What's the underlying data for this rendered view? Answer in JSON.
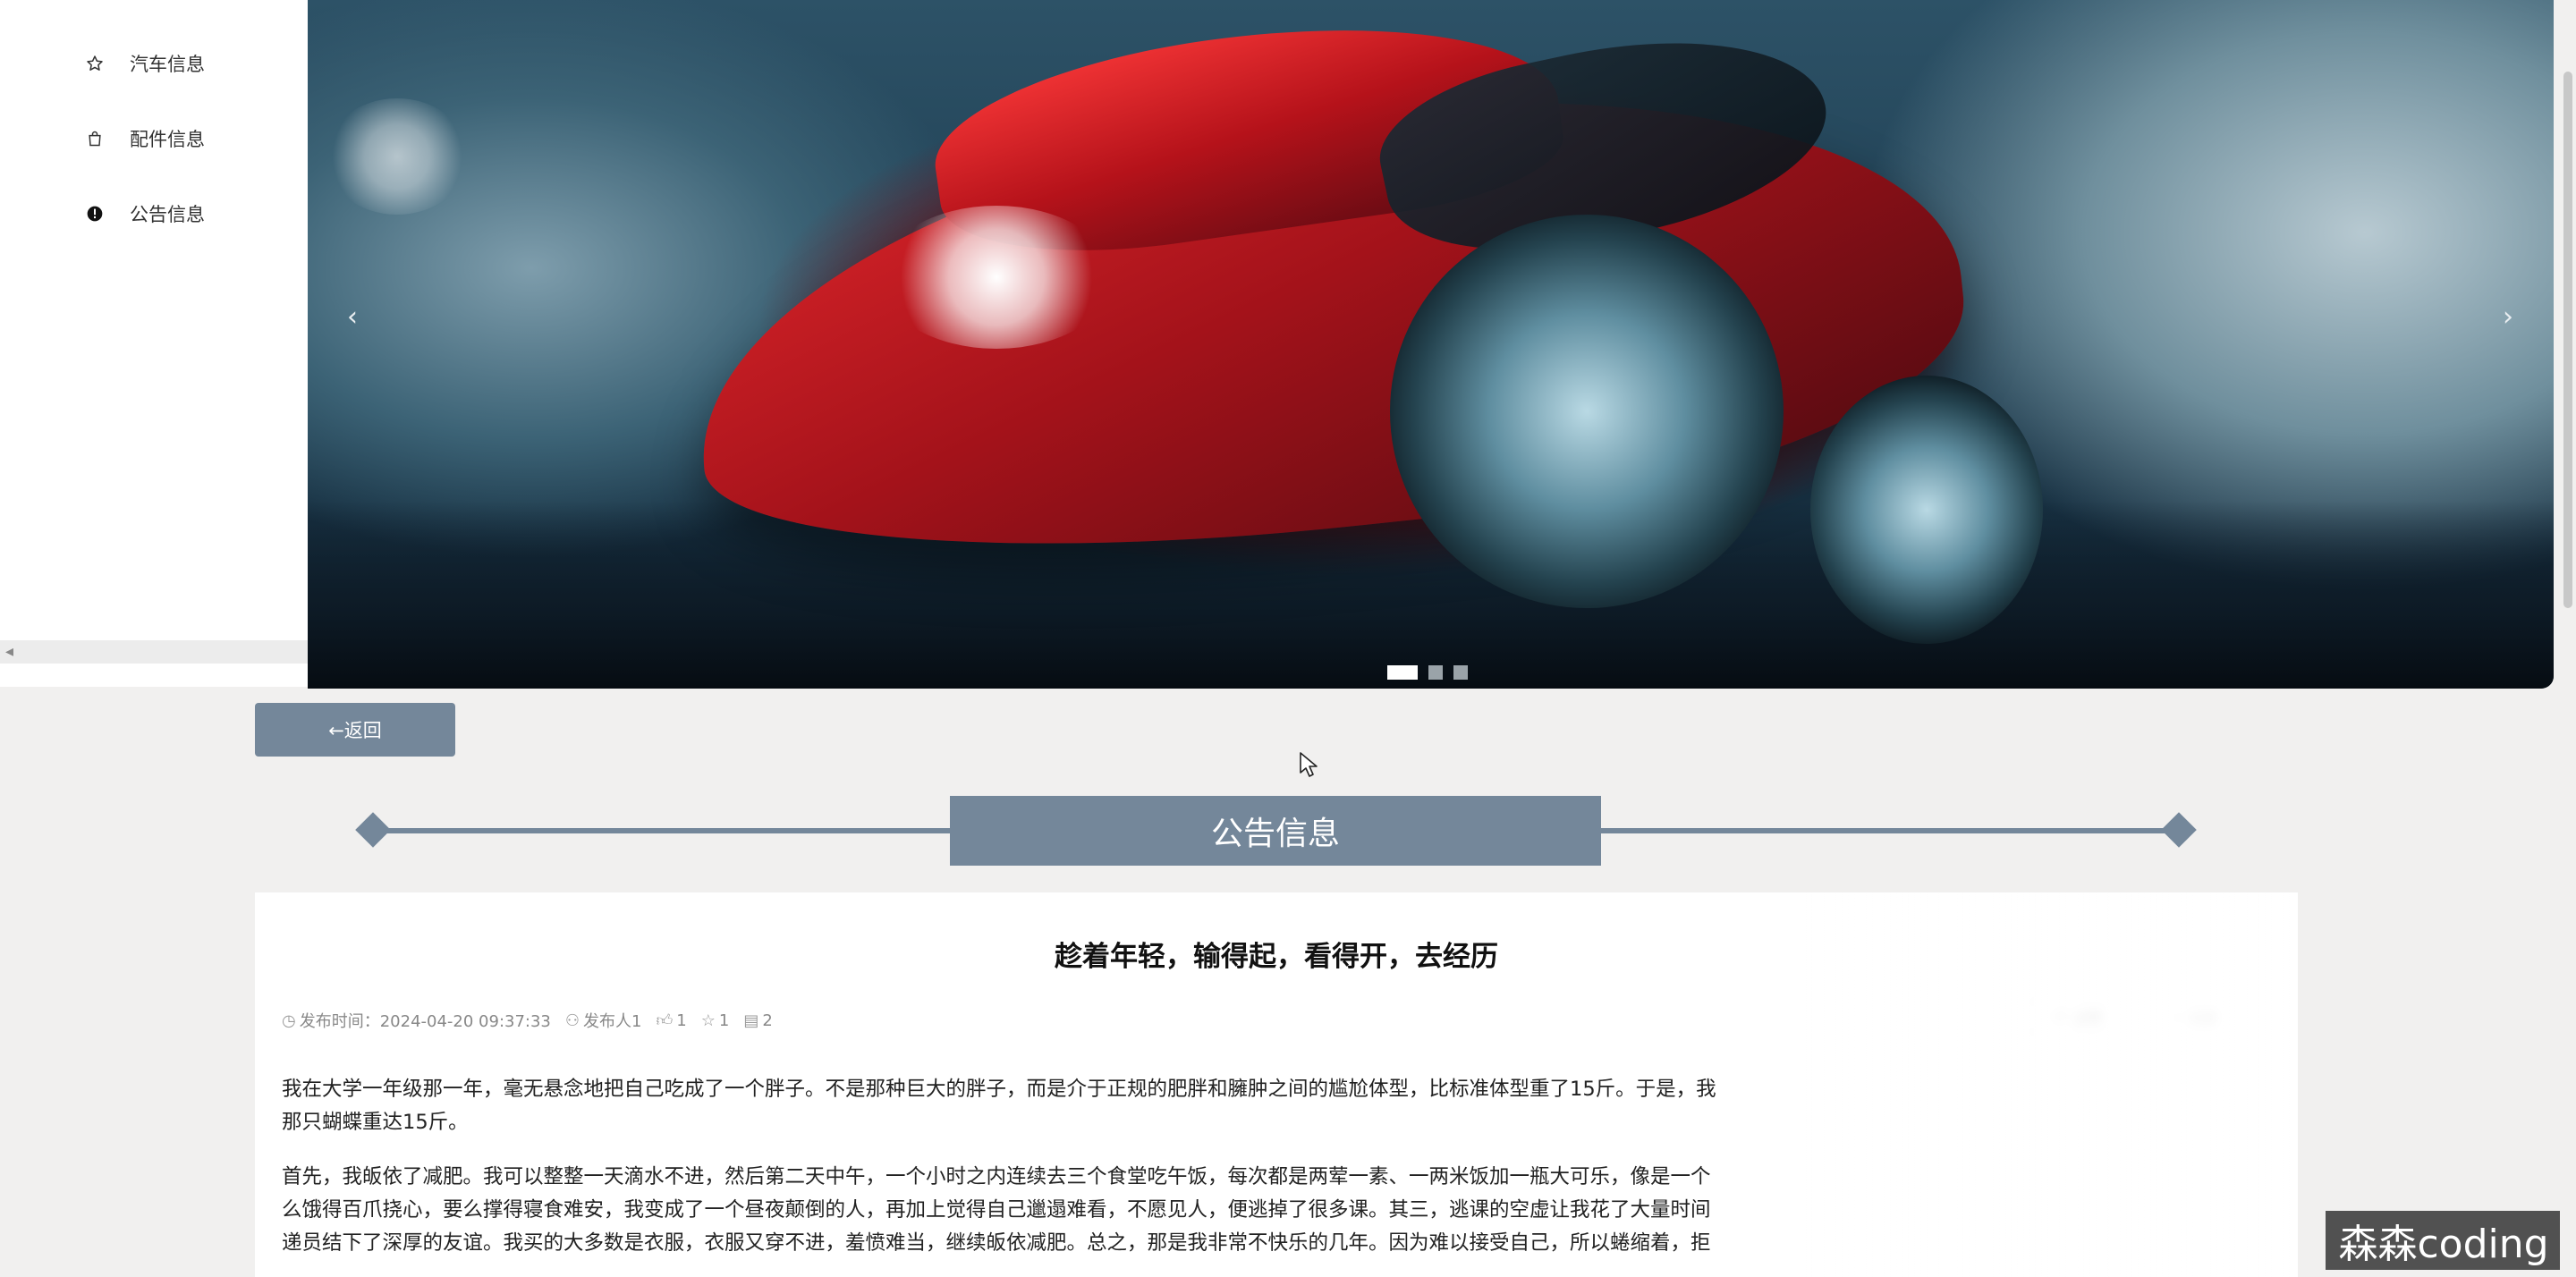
{
  "sidebar": {
    "items": [
      {
        "label": "汽车信息",
        "icon": "star-outline-icon"
      },
      {
        "label": "配件信息",
        "icon": "shopping-bag-icon"
      },
      {
        "label": "公告信息",
        "icon": "exclamation-circle-icon"
      }
    ]
  },
  "banner": {
    "prev_arrow": "‹",
    "next_arrow": "›",
    "slide_count": 3,
    "active_slide": 1
  },
  "back_button": {
    "label": "←返回"
  },
  "section": {
    "title": "公告信息"
  },
  "article": {
    "title": "趁着年轻，输得起，看得开，去经历",
    "meta": {
      "publish_time": "发布时间：2024-04-20 09:37:33",
      "publisher": "发布人1",
      "likes": "1",
      "favorites": "1",
      "comments": "2"
    },
    "like_button": "点赞",
    "favorite_button": "收藏",
    "paragraphs": [
      "我在大学一年级那一年，毫无悬念地把自己吃成了一个胖子。不是那种巨大的胖子，而是介于正规的肥胖和臃肿之间的尴尬体型，比标准体型重了15斤。于是，我",
      "那只蝴蝶重达15斤。",
      "首先，我皈依了减肥。我可以整整一天滴水不进，然后第二天中午，一个小时之内连续去三个食堂吃午饭，每次都是两荤一素、一两米饭加一瓶大可乐，像是一个",
      "么饿得百爪挠心，要么撑得寝食难安，我变成了一个昼夜颠倒的人，再加上觉得自己邋遢难看，不愿见人，便逃掉了很多课。其三，逃课的空虚让我花了大量时间",
      "递员结下了深厚的友谊。我买的大多数是衣服，衣服又穿不进，羞愤难当，继续皈依减肥。总之，那是我非常不快乐的几年。因为难以接受自己，所以蜷缩着，拒"
    ]
  },
  "watermark": {
    "text": "森森coding"
  },
  "colors": {
    "accent": "#74879a",
    "background": "#f1f0ef",
    "card": "#ffffff"
  }
}
